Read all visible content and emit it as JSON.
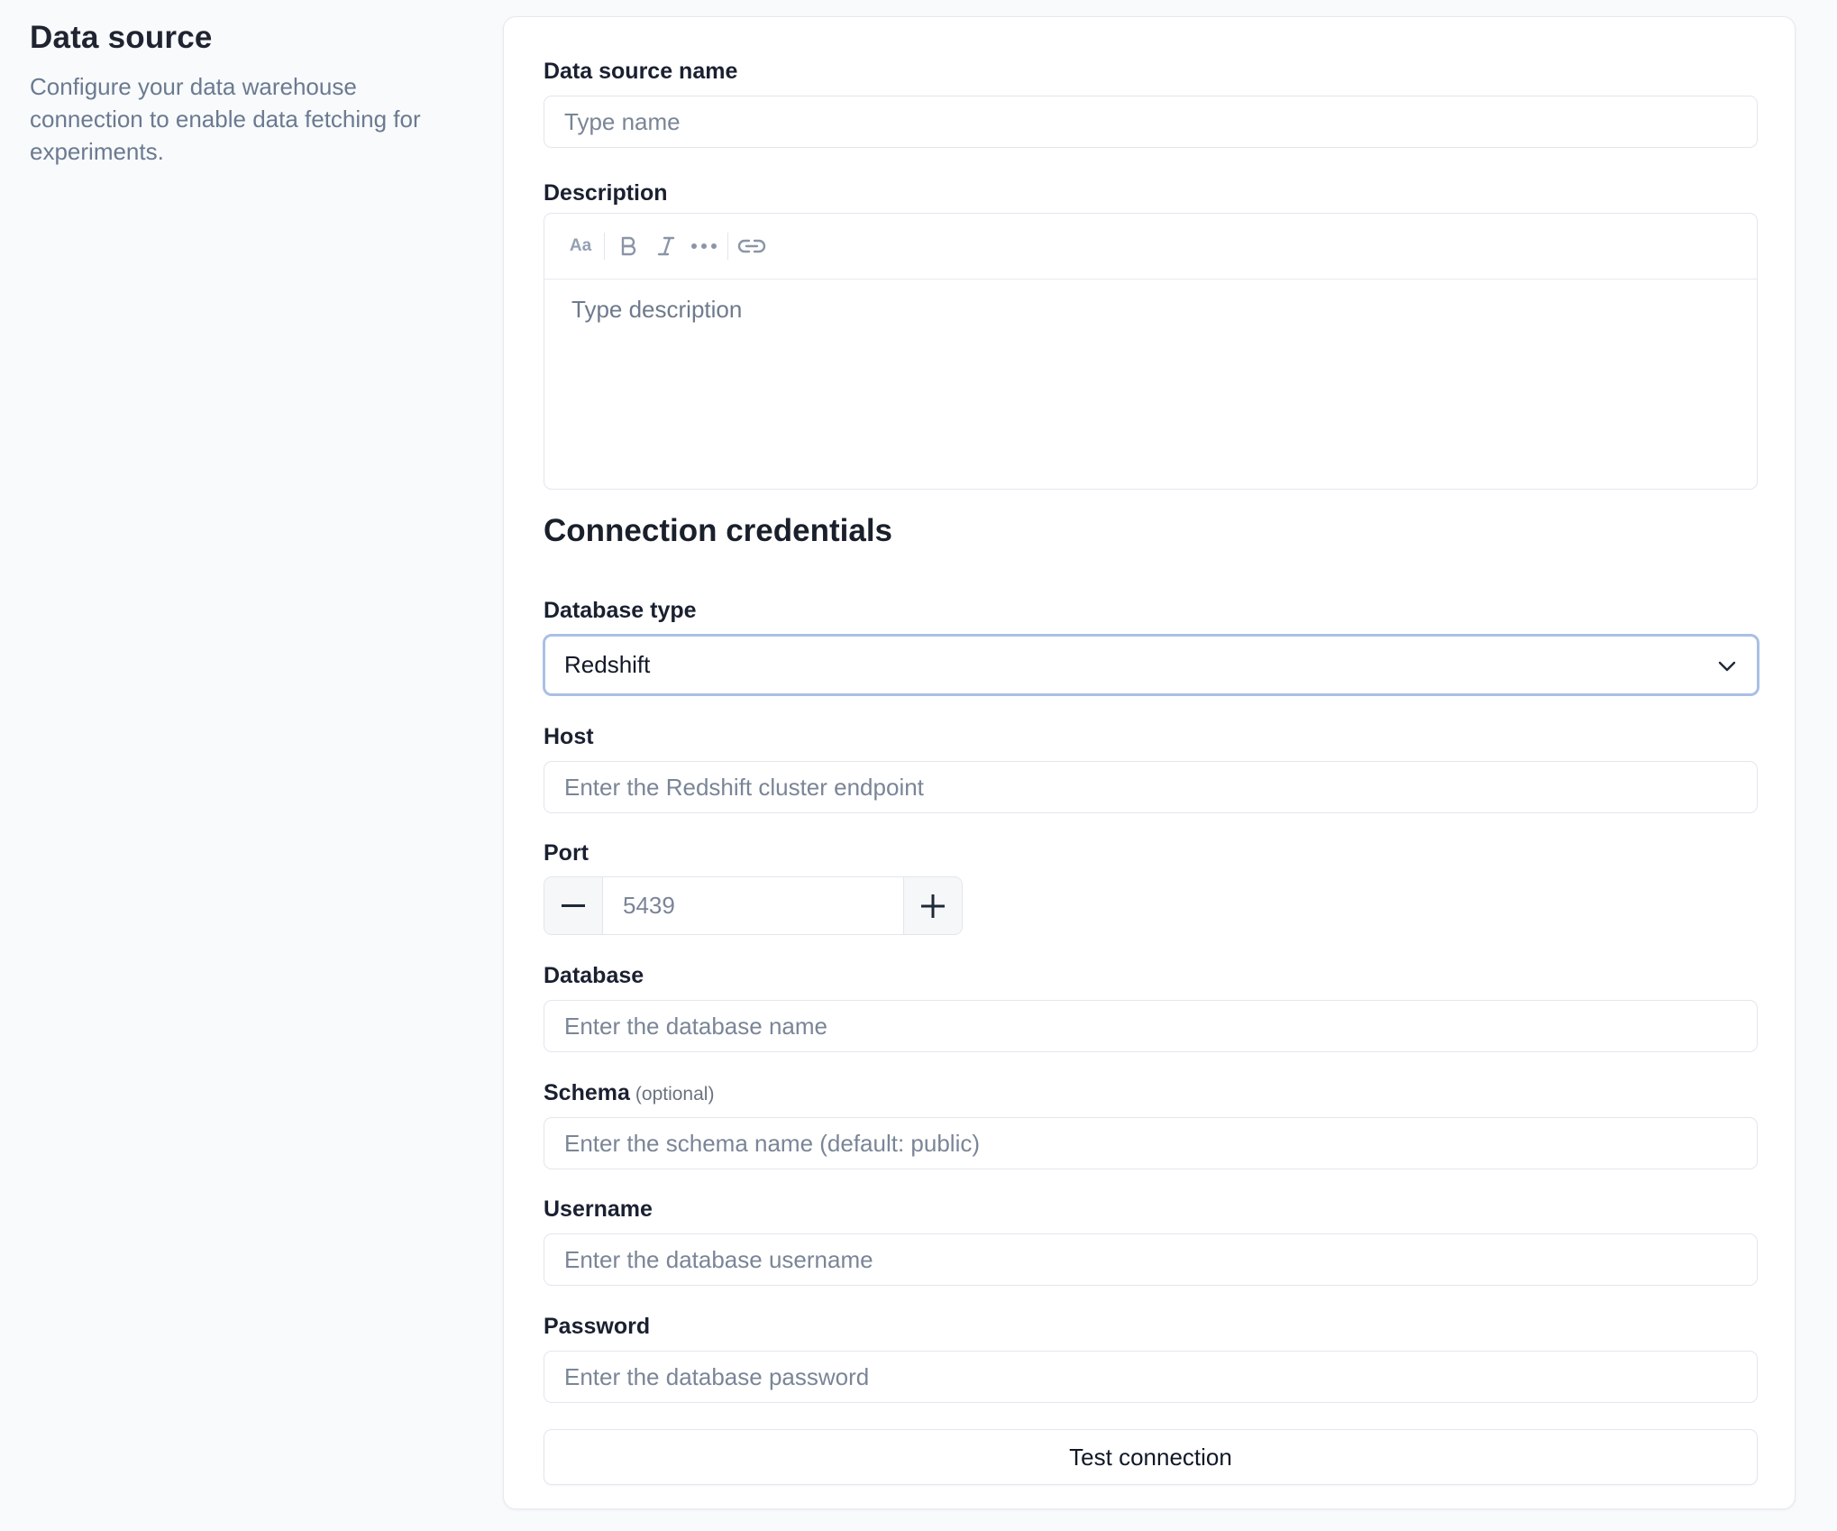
{
  "intro": {
    "title": "Data source",
    "description": "Configure your data warehouse connection to enable data fetching for experiments."
  },
  "form": {
    "name": {
      "label": "Data source name",
      "placeholder": "Type name",
      "value": ""
    },
    "description": {
      "label": "Description",
      "placeholder": "Type description",
      "toolbar": [
        {
          "icon": "font-size-icon",
          "glyph": "Aa"
        },
        {
          "icon": "bold-icon",
          "glyph": "B"
        },
        {
          "icon": "italic-icon",
          "glyph": "I"
        },
        {
          "icon": "more-icon",
          "glyph": "•••"
        },
        {
          "icon": "link-icon",
          "glyph": "link"
        }
      ]
    },
    "section_title": "Connection credentials",
    "database_type": {
      "label": "Database type",
      "selected": "Redshift",
      "icon": "chevron-down-icon"
    },
    "host": {
      "label": "Host",
      "placeholder": "Enter the Redshift cluster endpoint",
      "value": ""
    },
    "port": {
      "label": "Port",
      "value": "5439",
      "decrement_icon": "minus-icon",
      "increment_icon": "plus-icon"
    },
    "database": {
      "label": "Database",
      "placeholder": "Enter the database name",
      "value": ""
    },
    "schema": {
      "label": "Schema",
      "optional_note": "(optional)",
      "placeholder": "Enter the schema name (default: public)",
      "value": ""
    },
    "username": {
      "label": "Username",
      "placeholder": "Enter the database username",
      "value": ""
    },
    "password": {
      "label": "Password",
      "placeholder": "Enter the database password",
      "value": ""
    },
    "test_button": "Test connection"
  },
  "colors": {
    "page_bg": "#f8fafc",
    "card_bg": "#ffffff",
    "border": "#e2e6ec",
    "focus_border": "#aabfe6",
    "placeholder": "#7a8597",
    "muted_text": "#6b7a90"
  }
}
